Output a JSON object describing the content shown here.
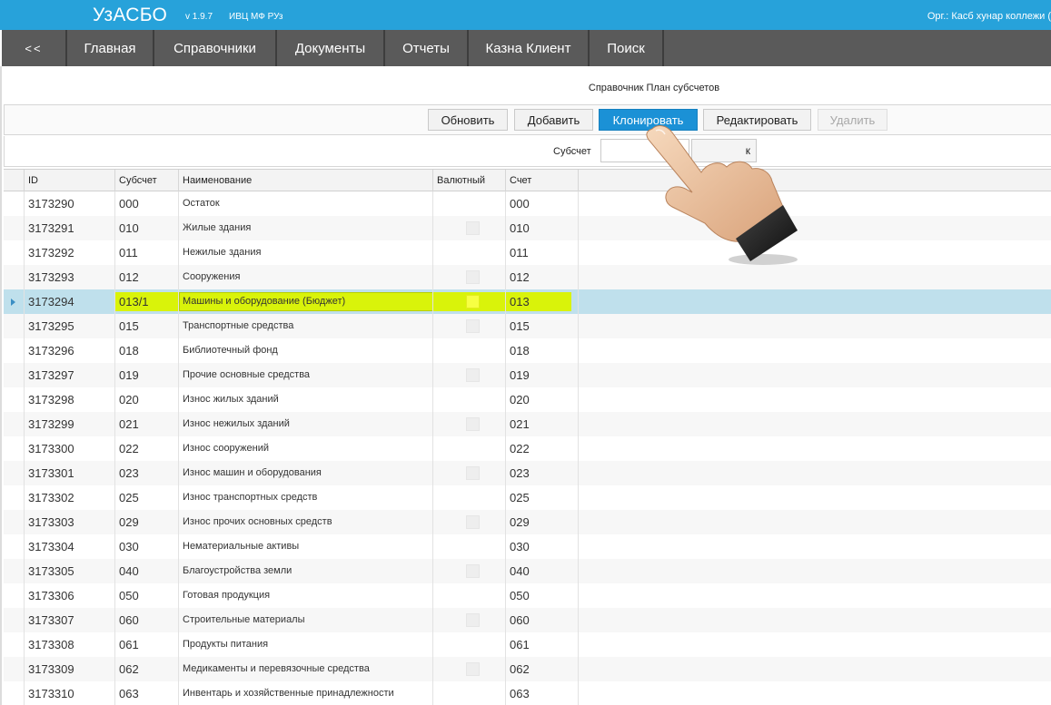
{
  "app": {
    "brand": "УзАСБО",
    "version": "v 1.9.7",
    "org_small": "ИВЦ МФ РУз",
    "org_right": "Орг.: Касб хунар коллежи ("
  },
  "nav": {
    "items": [
      "<<",
      "Главная",
      "Справочники",
      "Документы",
      "Отчеты",
      "Казна Клиент",
      "Поиск"
    ]
  },
  "page": {
    "title": "Справочник План субсчетов"
  },
  "toolbar": {
    "refresh": "Обновить",
    "add": "Добавить",
    "clone": "Клонировать",
    "edit": "Редактировать",
    "delete": "Удалить"
  },
  "filter": {
    "label": "Субсчет",
    "button_visible_text": "к",
    "input_value": ""
  },
  "grid": {
    "headers": [
      "ID",
      "Субсчет",
      "Наименование",
      "Валютный",
      "Счет"
    ],
    "selected_index": 4,
    "rows": [
      {
        "id": "3173290",
        "sub": "000",
        "name": "Остаток",
        "acc": "000"
      },
      {
        "id": "3173291",
        "sub": "010",
        "name": "Жилые здания",
        "acc": "010"
      },
      {
        "id": "3173292",
        "sub": "011",
        "name": "Нежилые здания",
        "acc": "011"
      },
      {
        "id": "3173293",
        "sub": "012",
        "name": "Сооружения",
        "acc": "012"
      },
      {
        "id": "3173294",
        "sub": "013/1",
        "name": "Машины и оборудование (Бюджет)",
        "acc": "013"
      },
      {
        "id": "3173295",
        "sub": "015",
        "name": "Транспортные средства",
        "acc": "015"
      },
      {
        "id": "3173296",
        "sub": "018",
        "name": "Библиотечный фонд",
        "acc": "018"
      },
      {
        "id": "3173297",
        "sub": "019",
        "name": "Прочие основные средства",
        "acc": "019"
      },
      {
        "id": "3173298",
        "sub": "020",
        "name": "Износ жилых зданий",
        "acc": "020"
      },
      {
        "id": "3173299",
        "sub": "021",
        "name": "Износ нежилых зданий",
        "acc": "021"
      },
      {
        "id": "3173300",
        "sub": "022",
        "name": "Износ сооружений",
        "acc": "022"
      },
      {
        "id": "3173301",
        "sub": "023",
        "name": "Износ машин и оборудования",
        "acc": "023"
      },
      {
        "id": "3173302",
        "sub": "025",
        "name": "Износ транспортных средств",
        "acc": "025"
      },
      {
        "id": "3173303",
        "sub": "029",
        "name": "Износ прочих основных средств",
        "acc": "029"
      },
      {
        "id": "3173304",
        "sub": "030",
        "name": "Нематериальные активы",
        "acc": "030"
      },
      {
        "id": "3173305",
        "sub": "040",
        "name": "Благоустройства земли",
        "acc": "040"
      },
      {
        "id": "3173306",
        "sub": "050",
        "name": "Готовая продукция",
        "acc": "050"
      },
      {
        "id": "3173307",
        "sub": "060",
        "name": "Строительные материалы",
        "acc": "060"
      },
      {
        "id": "3173308",
        "sub": "061",
        "name": "Продукты питания",
        "acc": "061"
      },
      {
        "id": "3173309",
        "sub": "062",
        "name": "Медикаменты и перевязочные средства",
        "acc": "062"
      },
      {
        "id": "3173310",
        "sub": "063",
        "name": "Инвентарь и хозяйственные принадлежности",
        "acc": "063"
      }
    ]
  },
  "colors": {
    "topbar": "#27a2da",
    "nav": "#5a5a5a",
    "primary_button": "#1b91d6",
    "selected_row": "#bfe0ec",
    "highlight": "#d9f30a"
  },
  "icons": {
    "pointer": "hand-pointer-icon",
    "row_indicator": "row-pointer-icon"
  }
}
